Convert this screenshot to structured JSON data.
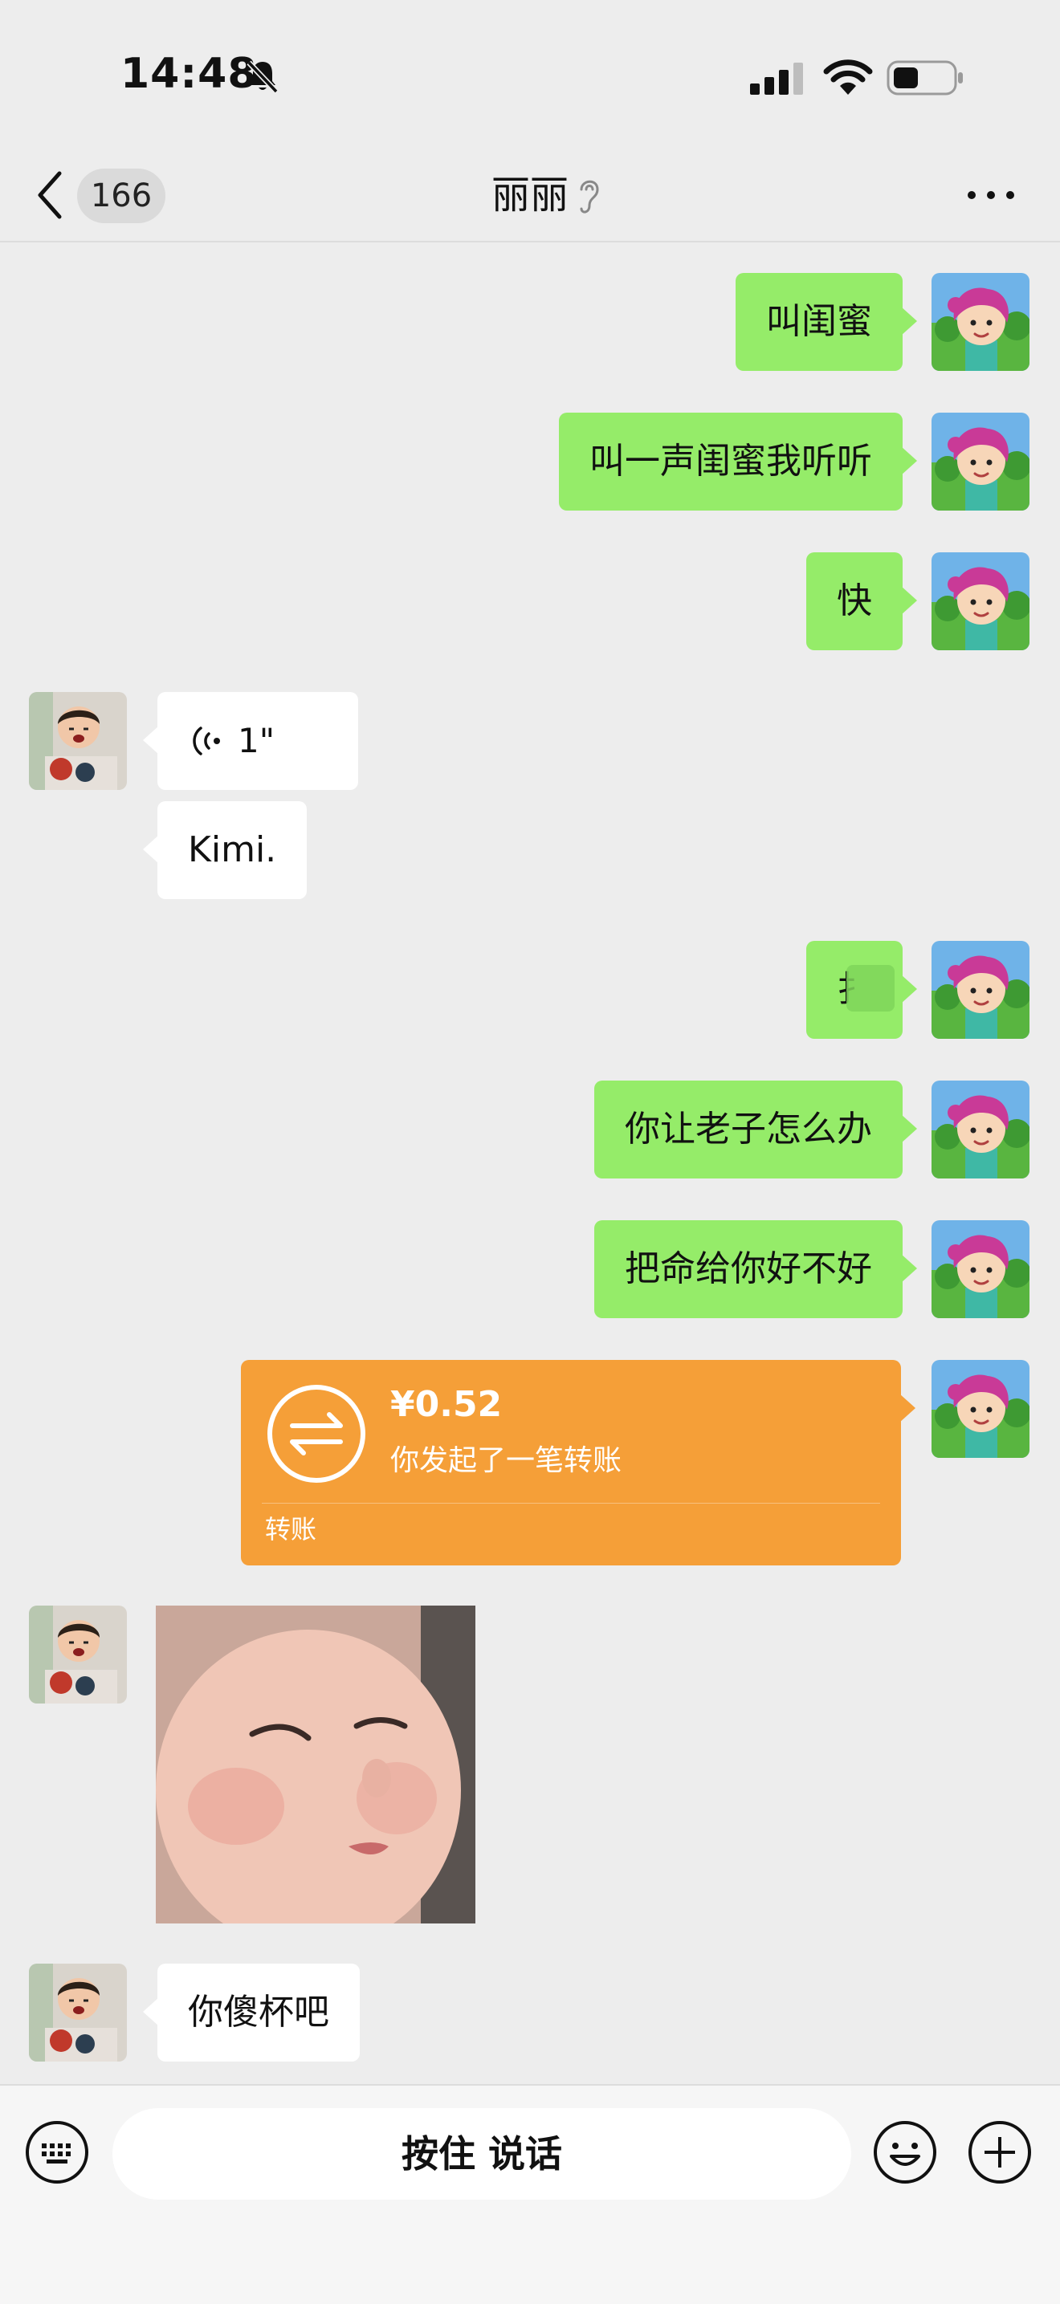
{
  "status_bar": {
    "time": "14:48"
  },
  "nav": {
    "unread_count": "166",
    "title": "丽丽"
  },
  "messages": [
    {
      "from": "me",
      "text": "叫闺蜜"
    },
    {
      "from": "me",
      "text": "叫一声闺蜜我听听"
    },
    {
      "from": "me",
      "text": "快"
    },
    {
      "from": "them",
      "type": "voice",
      "duration": "1\""
    },
    {
      "from": "them",
      "text": "Kimi."
    },
    {
      "from": "me",
      "text": "扌"
    },
    {
      "from": "me",
      "text": "你让老子怎么办"
    },
    {
      "from": "me",
      "text": "把命给你好不好"
    },
    {
      "from": "me",
      "type": "transfer",
      "amount": "¥0.52",
      "desc": "你发起了一笔转账",
      "label": "转账"
    },
    {
      "from": "them",
      "type": "image"
    },
    {
      "from": "them",
      "text": "你傻杯吧"
    }
  ],
  "input_bar": {
    "hold_to_talk": "按住 说话"
  },
  "colors": {
    "my_bubble": "#95ec69",
    "their_bubble": "#ffffff",
    "transfer": "#f59f38",
    "background": "#ededed"
  }
}
